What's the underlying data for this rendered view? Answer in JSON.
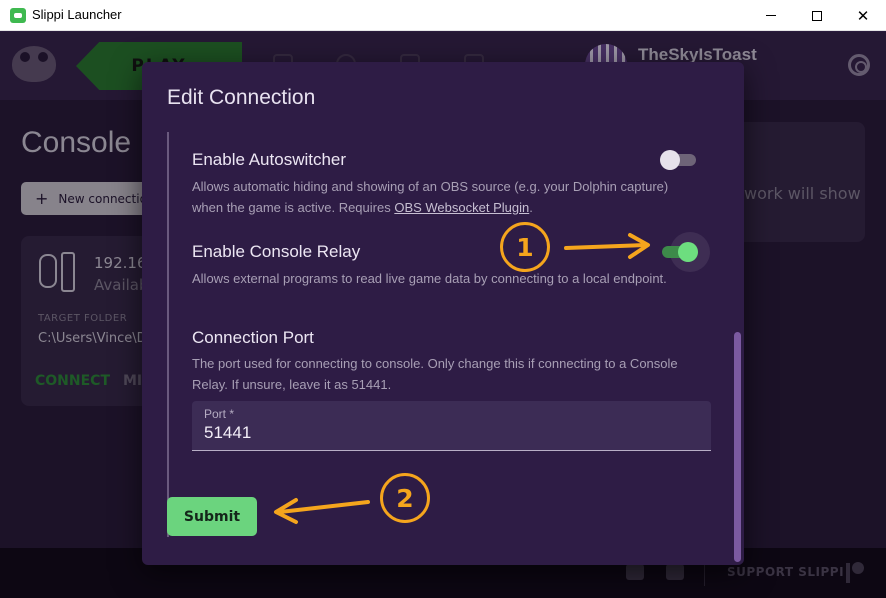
{
  "window": {
    "title": "Slippi Launcher",
    "minimize": "",
    "maximize": "",
    "close": "✕"
  },
  "header": {
    "play_label": "PLAY",
    "username": "TheSkyIsToast"
  },
  "page": {
    "title": "Console",
    "new_connection_label": "New connectio",
    "card": {
      "ip": "192.168",
      "status": "Availab",
      "target_folder_label": "TARGET FOLDER",
      "target_folder": "C:\\Users\\Vince\\D",
      "connect_label": "CONNECT",
      "mirror_label": "MI"
    },
    "right_panel_text": "work will show"
  },
  "modal": {
    "title": "Edit Connection",
    "autoswitcher": {
      "title": "Enable Autoswitcher",
      "desc_prefix": "Allows automatic hiding and showing of an OBS source (e.g. your Dolphin capture) when the game is active. Requires ",
      "link": "OBS Websocket Plugin",
      "desc_suffix": ".",
      "enabled": false
    },
    "console_relay": {
      "title": "Enable Console Relay",
      "desc": "Allows external programs to read live game data by connecting to a local endpoint.",
      "enabled": true
    },
    "port": {
      "title": "Connection Port",
      "desc": "The port used for connecting to console. Only change this if connecting to a Console Relay. If unsure, leave it as 51441.",
      "field_label": "Port *",
      "value": "51441"
    },
    "submit_label": "Submit"
  },
  "annotations": {
    "badge_1": "1",
    "badge_2": "2",
    "accent_color": "#f5a51d"
  },
  "footer": {
    "support_label": "SUPPORT SLIPPI",
    "icons": [
      "twitter-icon",
      "discord-icon",
      "patreon-icon"
    ]
  }
}
